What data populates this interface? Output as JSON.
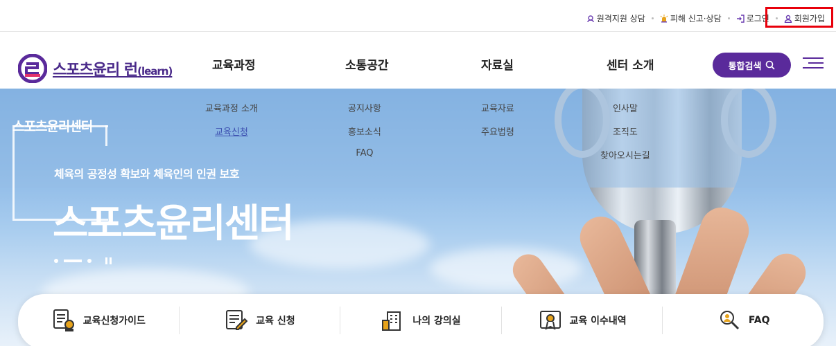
{
  "util": {
    "remote": "원격지원 상담",
    "report": "피해 신고·상담",
    "login": "로그인",
    "signup": "회원가입"
  },
  "header": {
    "logo_main": "스포츠윤리 런",
    "logo_sub": "(learn)",
    "nav": [
      "교육과정",
      "소통공간",
      "자료실",
      "센터 소개"
    ],
    "search_label": "통합검색"
  },
  "dropdown": {
    "col1": [
      "교육과정 소개",
      "교육신청"
    ],
    "col2": [
      "공지사항",
      "홍보소식",
      "FAQ"
    ],
    "col3": [
      "교육자료",
      "주요법령"
    ],
    "col4": [
      "인사말",
      "조직도",
      "찾아오시는길"
    ]
  },
  "hero": {
    "side_title": "스포츠윤리센터",
    "subtitle": "체육의 공정성 확보와 체육인의 인권 보호",
    "title": "스포츠윤리센터"
  },
  "quick": [
    "교육신청가이드",
    "교육 신청",
    "나의 강의실",
    "교육 이수내역",
    "FAQ"
  ],
  "colors": {
    "brand": "#5a2a9b",
    "logo": "#4a2a8a",
    "highlight": "#e8000b"
  }
}
